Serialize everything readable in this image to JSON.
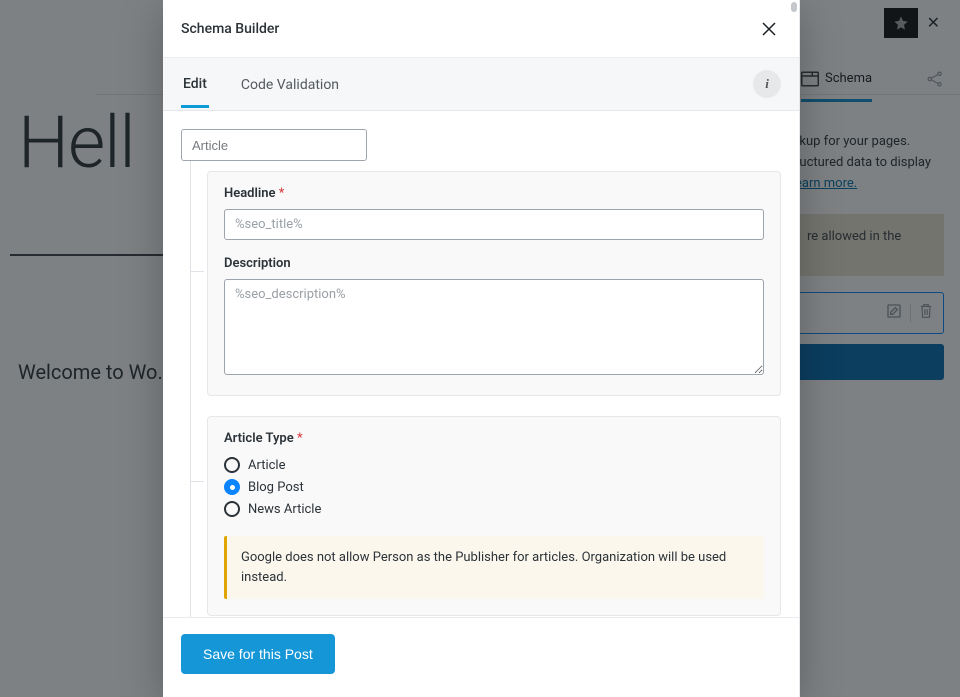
{
  "background": {
    "heading": "Hell",
    "paragraph": "Welcome to Wo… start writing!"
  },
  "sidebar": {
    "tab_label": "Schema",
    "text1": "rkup for your pages.",
    "text2": "ructured data to display",
    "learn_more": "earn more.",
    "notice": "re allowed in the"
  },
  "modal": {
    "title": "Schema Builder",
    "tabs": {
      "edit": "Edit",
      "code": "Code Validation"
    },
    "schema_type": "Article",
    "headline": {
      "label": "Headline",
      "placeholder": "%seo_title%",
      "value": ""
    },
    "description": {
      "label": "Description",
      "placeholder": "%seo_description%",
      "value": ""
    },
    "article_type": {
      "label": "Article Type",
      "options": [
        "Article",
        "Blog Post",
        "News Article"
      ],
      "selected": "Blog Post"
    },
    "warning": "Google does not allow Person as the Publisher for articles. Organization will be used instead.",
    "save": "Save for this Post"
  }
}
